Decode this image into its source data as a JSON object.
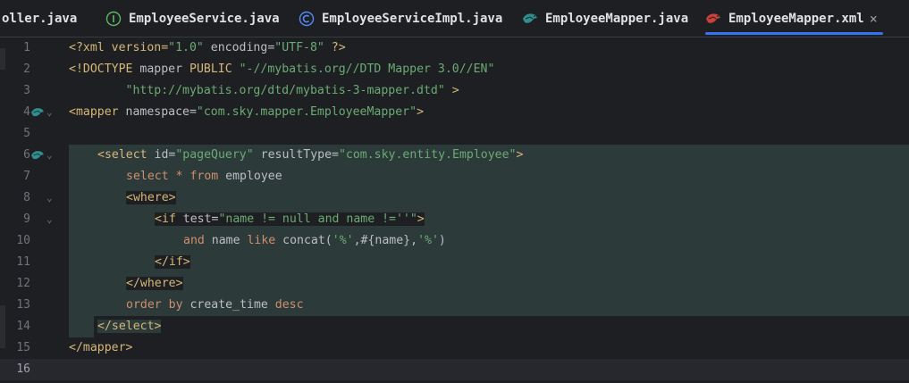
{
  "tabs": [
    {
      "label": "oller.java",
      "icon": "none"
    },
    {
      "label": "EmployeeService.java",
      "icon": "interface-icon"
    },
    {
      "label": "EmployeeServiceImpl.java",
      "icon": "class-icon"
    },
    {
      "label": "EmployeeMapper.java",
      "icon": "mybatis-bird-icon"
    },
    {
      "label": "EmployeeMapper.xml",
      "icon": "mybatis-bird-icon",
      "active": true
    }
  ],
  "close_glyph": "×",
  "line_numbers": [
    "1",
    "2",
    "3",
    "4",
    "5",
    "6",
    "7",
    "8",
    "9",
    "10",
    "11",
    "12",
    "13",
    "14",
    "15",
    "16"
  ],
  "fold_glyph": "⌄",
  "code": {
    "l1": {
      "a": "<?xml version=",
      "b": "\"1.0\"",
      "c": " encoding=",
      "d": "\"UTF-8\"",
      "e": " ?>"
    },
    "l2": {
      "a": "<!DOCTYPE",
      "b": " mapper ",
      "c": "PUBLIC",
      "d": " \"-//mybatis.org//DTD Mapper 3.0//EN\""
    },
    "l3": {
      "a": "        \"http://mybatis.org/dtd/mybatis-3-mapper.dtd\"",
      "b": " >"
    },
    "l4": {
      "a": "<mapper",
      "b": " namespace=",
      "c": "\"com.sky.mapper.EmployeeMapper\"",
      "d": ">"
    },
    "l6": {
      "a": "<select",
      "b": " id=",
      "c": "\"pageQuery\"",
      "d": " resultType=",
      "e": "\"com.sky.entity.Employee\"",
      "f": ">"
    },
    "l7": {
      "a": "select",
      "b": " * ",
      "c": "from",
      "d": " employee"
    },
    "l8": {
      "a": "<where>"
    },
    "l9": {
      "a": "<if",
      "b": " test=",
      "c": "\"name != null ",
      "d": "and",
      "e": " name !=''\"",
      "f": ">"
    },
    "l10": {
      "a": "and",
      "b": " name ",
      "c": "like",
      "d": " concat(",
      "e": "'%'",
      "f": ",#{name},",
      "g": "'%'",
      "h": ")"
    },
    "l11": {
      "a": "</if>"
    },
    "l12": {
      "a": "</where>"
    },
    "l13": {
      "a": "order",
      "b": " ",
      "c": "by",
      "d": " create_time ",
      "e": "desc"
    },
    "l14": {
      "a": "</select>"
    },
    "l15": {
      "a": "</mapper>"
    }
  },
  "colors": {
    "background": "#1e1f22",
    "tag": "#d5b778",
    "string": "#6aab73",
    "keyword": "#cf8e6d",
    "text": "#bcbec4",
    "selection_region": "#2c3a3a",
    "tab_underline": "#3574f0"
  }
}
